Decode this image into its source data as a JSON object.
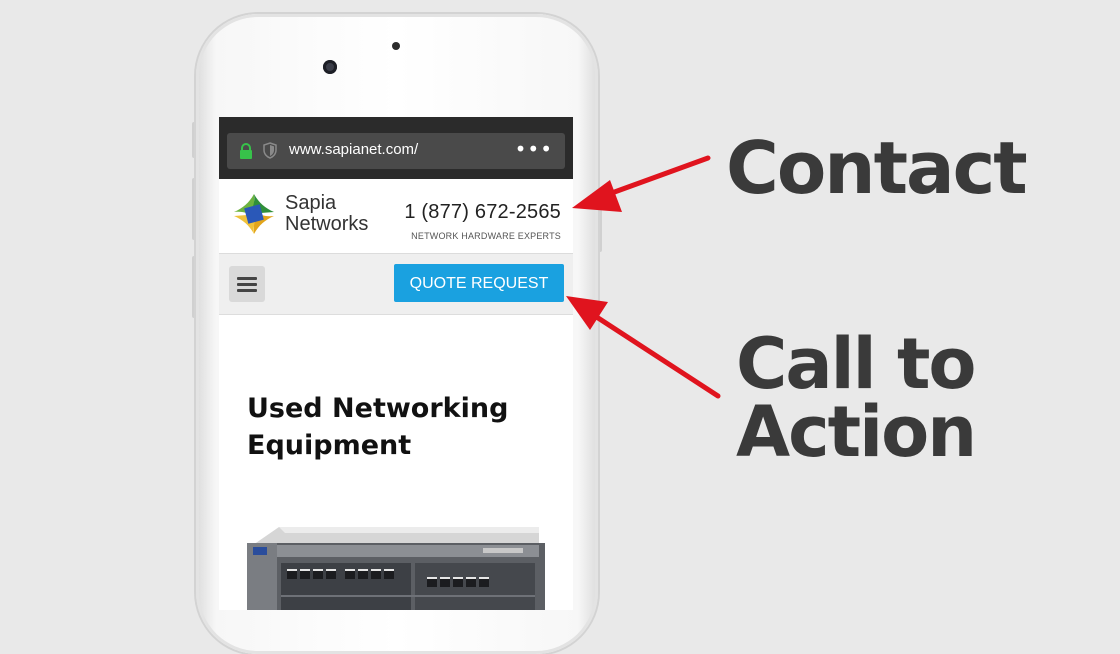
{
  "browser": {
    "url": "www.sapianet.com/",
    "more_icon": "more-dots-icon",
    "lock_color": "#37c24a"
  },
  "site": {
    "logo_line1": "Sapia",
    "logo_line2": "Networks",
    "phone": "1 (877) 672-2565",
    "tagline": "NETWORK HARDWARE EXPERTS",
    "cta_label": "QUOTE REQUEST",
    "cta_color": "#1aa1e0",
    "hero_title_line1": "Used Networking",
    "hero_title_line2": "Equipment"
  },
  "annotations": {
    "contact": "Contact",
    "cta_line1": "Call to",
    "cta_line2": "Action",
    "arrow_color": "#e0141e"
  }
}
